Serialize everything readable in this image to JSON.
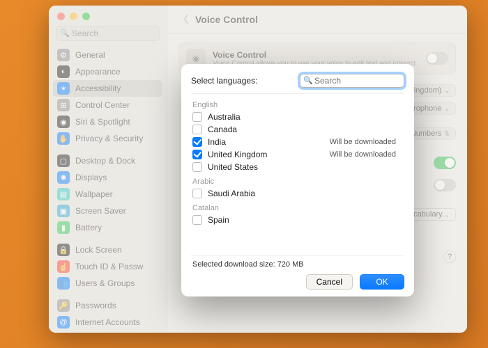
{
  "sidebar": {
    "search_placeholder": "Search",
    "groups": [
      [
        {
          "label": "General",
          "icon": "⚙",
          "bg": "#8e8e93"
        },
        {
          "label": "Appearance",
          "icon": "◐",
          "bg": "#1c1c1e"
        },
        {
          "label": "Accessibility",
          "icon": "✶",
          "bg": "#0a7aff",
          "selected": true
        },
        {
          "label": "Control Center",
          "icon": "⊞",
          "bg": "#8e8e93"
        },
        {
          "label": "Siri & Spotlight",
          "icon": "◉",
          "bg": "#1c1c1e"
        },
        {
          "label": "Privacy & Security",
          "icon": "✋",
          "bg": "#0a7aff"
        }
      ],
      [
        {
          "label": "Desktop & Dock",
          "icon": "▢",
          "bg": "#1c1c1e"
        },
        {
          "label": "Displays",
          "icon": "✺",
          "bg": "#0a7aff"
        },
        {
          "label": "Wallpaper",
          "icon": "▤",
          "bg": "#34c7c0"
        },
        {
          "label": "Screen Saver",
          "icon": "▣",
          "bg": "#2aa7d4"
        },
        {
          "label": "Battery",
          "icon": "▮",
          "bg": "#34c759"
        }
      ],
      [
        {
          "label": "Lock Screen",
          "icon": "🔒",
          "bg": "#1c1c1e"
        },
        {
          "label": "Touch ID & Passw",
          "icon": "☝",
          "bg": "#ff3b30"
        },
        {
          "label": "Users & Groups",
          "icon": "👥",
          "bg": "#0a7aff"
        }
      ],
      [
        {
          "label": "Passwords",
          "icon": "🔑",
          "bg": "#8e8e93"
        },
        {
          "label": "Internet Accounts",
          "icon": "@",
          "bg": "#0a7aff"
        }
      ]
    ]
  },
  "main": {
    "title": "Voice Control",
    "vc": {
      "title": "Voice Control",
      "subtitle": "Voice Control allows you to use your voice to edit text and interact"
    },
    "language_value": "nited Kingdom)",
    "mic_value": "Air Microphone",
    "overlay_value": "Item Numbers",
    "vocab_btn": "Vocabulary...",
    "help": "?"
  },
  "modal": {
    "title": "Select languages:",
    "search_placeholder": "Search",
    "groups": [
      {
        "label": "English",
        "items": [
          {
            "name": "Australia",
            "checked": false
          },
          {
            "name": "Canada",
            "checked": false
          },
          {
            "name": "India",
            "checked": true,
            "note": "Will be downloaded"
          },
          {
            "name": "United Kingdom",
            "checked": true,
            "note": "Will be downloaded"
          },
          {
            "name": "United States",
            "checked": false
          }
        ]
      },
      {
        "label": "Arabic",
        "items": [
          {
            "name": "Saudi Arabia",
            "checked": false
          }
        ]
      },
      {
        "label": "Catalan",
        "items": [
          {
            "name": "Spain",
            "checked": false
          }
        ]
      }
    ],
    "footer": "Selected download size: 720 MB",
    "cancel": "Cancel",
    "ok": "OK"
  }
}
